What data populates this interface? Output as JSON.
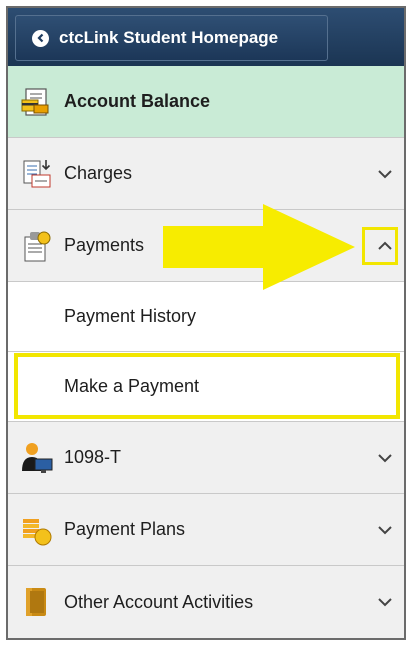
{
  "header": {
    "back_label": "ctcLink Student Homepage",
    "cropped_text": "e"
  },
  "menu": {
    "active": {
      "label": "Account Balance",
      "icon": "account-balance-icon"
    },
    "items": [
      {
        "label": "Charges",
        "icon": "charges-icon",
        "expanded": false
      },
      {
        "label": "Payments",
        "icon": "payments-icon",
        "expanded": true,
        "subitems": [
          {
            "label": "Payment History"
          },
          {
            "label": "Make a Payment"
          }
        ]
      },
      {
        "label": "1098-T",
        "icon": "person-computer-icon",
        "expanded": false
      },
      {
        "label": "Payment Plans",
        "icon": "coins-icon",
        "expanded": false
      },
      {
        "label": "Other Account Activities",
        "icon": "folder-icon",
        "expanded": false
      }
    ]
  },
  "colors": {
    "header_bg": "#1f3a5c",
    "active_bg": "#c9ebd6",
    "row_bg": "#f0f0f0",
    "highlight": "#f2e600"
  }
}
